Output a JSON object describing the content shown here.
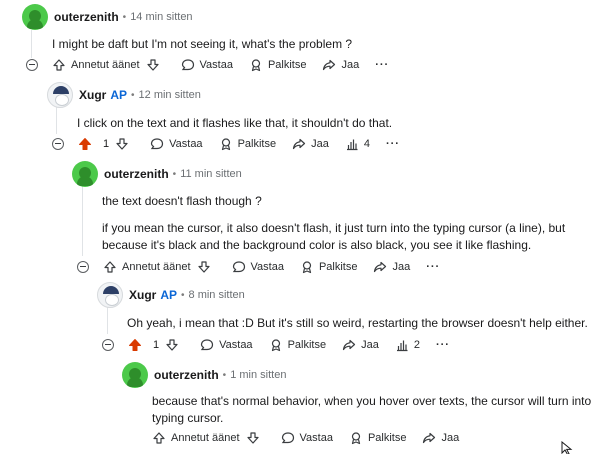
{
  "comments": [
    {
      "username": "outerzenith",
      "op": "",
      "time": "14 min sitten",
      "text": "I might be daft but I'm not seeing it, what's the problem ?",
      "actions": {
        "upvote": "Annetut äänet",
        "reply": "Vastaa",
        "award": "Palkitse",
        "share": "Jaa",
        "more": "···"
      }
    },
    {
      "username": "Xugr",
      "op": "AP",
      "time": "12 min sitten",
      "text": "I click on the text and it flashes like that, it shouldn't do that.",
      "actions": {
        "votes": "1",
        "reply": "Vastaa",
        "award": "Palkitse",
        "share": "Jaa",
        "stats": "4",
        "more": "···"
      }
    },
    {
      "username": "outerzenith",
      "op": "",
      "time": "11 min sitten",
      "text1": "the text doesn't flash though ?",
      "text2": "if you mean the cursor, it also doesn't flash, it just turn into the typing cursor (a line), but because it's black and the background color is also black, you see it like flashing.",
      "actions": {
        "upvote": "Annetut äänet",
        "reply": "Vastaa",
        "award": "Palkitse",
        "share": "Jaa",
        "more": "···"
      }
    },
    {
      "username": "Xugr",
      "op": "AP",
      "time": "8 min sitten",
      "text": "Oh yeah, i mean that :D But it's still so weird, restarting the browser doesn't help either.",
      "actions": {
        "votes": "1",
        "reply": "Vastaa",
        "award": "Palkitse",
        "share": "Jaa",
        "stats": "2",
        "more": "···"
      }
    },
    {
      "username": "outerzenith",
      "op": "",
      "time": "1 min sitten",
      "text": "because that's normal behavior, when you hover over texts, the cursor will turn into typing cursor.",
      "actions": {
        "upvote": "Annetut äänet",
        "reply": "Vastaa",
        "award": "Palkitse",
        "share": "Jaa"
      }
    }
  ],
  "colors": {
    "upvote_active": "#d93a00",
    "op_tag": "#0a66d6",
    "thread_line": "#e0e3e6"
  },
  "icons": [
    "upvote-icon",
    "downvote-icon",
    "reply-bubble-icon",
    "award-icon",
    "share-arrow-icon",
    "stats-bars-icon",
    "more-icon",
    "collapse-icon"
  ]
}
